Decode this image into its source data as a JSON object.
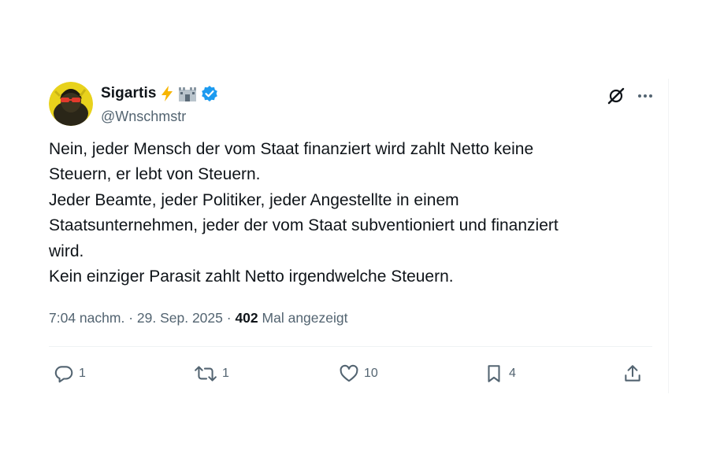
{
  "tweet": {
    "display_name": "Sigartis",
    "name_emojis": [
      "lightning-icon",
      "castle-icon"
    ],
    "handle": "@Wnschmstr",
    "verified": true,
    "accent_color": "#1d9bf0",
    "text_lines": [
      "Nein, jeder Mensch der vom Staat finanziert wird zahlt Netto keine",
      "Steuern, er lebt von Steuern.",
      "Jeder Beamte, jeder Politiker, jeder Angestellte in einem",
      "Staatsunternehmen, jeder der vom Staat subventioniert und finanziert",
      "wird.",
      "Kein einziger Parasit zahlt Netto irgendwelche Steuern."
    ],
    "time": "7:04 nachm.",
    "separator": "·",
    "date": "29. Sep. 2025",
    "views_count": "402",
    "views_label": "Mal angezeigt"
  },
  "actions": {
    "reply_count": "1",
    "retweet_count": "1",
    "like_count": "10",
    "bookmark_count": "4"
  },
  "icons": {
    "top_right": [
      "grok-icon",
      "more-icon"
    ],
    "action_bar": [
      "reply-icon",
      "retweet-icon",
      "like-icon",
      "bookmark-icon",
      "share-icon"
    ]
  }
}
